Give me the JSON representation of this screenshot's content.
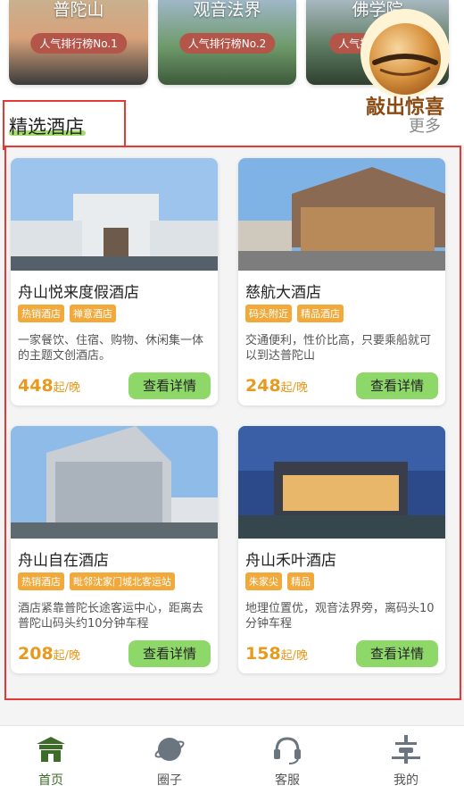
{
  "attractions": [
    {
      "name": "普陀山",
      "badge": "人气排行榜No.1"
    },
    {
      "name": "观音法界",
      "badge": "人气排行榜No.2"
    },
    {
      "name": "佛学院",
      "badge": "人气排行榜No.3"
    }
  ],
  "promo": {
    "text": "敲出惊喜"
  },
  "section": {
    "title": "精选酒店",
    "more": "更多"
  },
  "hotels": [
    {
      "name": "舟山悦来度假酒店",
      "tags": [
        "热销酒店",
        "禅意酒店"
      ],
      "desc": "一家餐饮、住宿、购物、休闲集一体的主题文创酒店。",
      "price": "448",
      "unit": "起/晚",
      "button": "查看详情"
    },
    {
      "name": "慈航大酒店",
      "tags": [
        "码头附近",
        "精品酒店"
      ],
      "desc": "交通便利，性价比高，只要乘船就可以到达普陀山",
      "price": "248",
      "unit": "起/晚",
      "button": "查看详情"
    },
    {
      "name": "舟山自在酒店",
      "tags": [
        "热销酒店",
        "毗邻沈家门城北客运站"
      ],
      "desc": "酒店紧靠普陀长途客运中心，距离去普陀山码头约10分钟车程",
      "price": "208",
      "unit": "起/晚",
      "button": "查看详情"
    },
    {
      "name": "舟山禾叶酒店",
      "tags": [
        "朱家尖",
        "精品"
      ],
      "desc": "地理位置优，观音法界旁，离码头10分钟车程",
      "price": "158",
      "unit": "起/晚",
      "button": "查看详情"
    }
  ],
  "tabbar": [
    {
      "label": "首页",
      "icon": "temple-icon"
    },
    {
      "label": "圈子",
      "icon": "planet-icon"
    },
    {
      "label": "客服",
      "icon": "headset-icon"
    },
    {
      "label": "我的",
      "icon": "user-icon"
    }
  ],
  "colors": {
    "accent": "#8ed86a",
    "price": "#e89a1e",
    "tag": "#f2a93b",
    "highlight": "#e53935"
  }
}
